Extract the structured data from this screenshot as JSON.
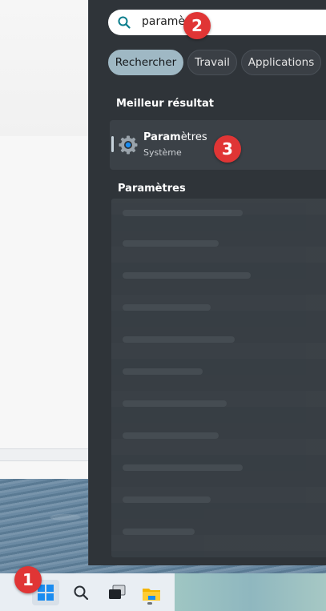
{
  "search": {
    "query": "paramè"
  },
  "filters": [
    {
      "label": "Rechercher",
      "active": true
    },
    {
      "label": "Travail",
      "active": false
    },
    {
      "label": "Applications",
      "active": false
    }
  ],
  "best_result": {
    "section_title": "Meilleur résultat",
    "title_match": "Param",
    "title_rest": "ètres",
    "subtitle": "Système"
  },
  "settings_section": {
    "title": "Paramètres"
  },
  "taskbar": {
    "icons": [
      "windows-start-icon",
      "search-icon",
      "task-view-icon",
      "file-explorer-icon"
    ]
  },
  "badges": [
    "1",
    "2",
    "3"
  ],
  "colors": {
    "panel_bg": "#2f3439",
    "accent_pill": "#9fb8c4",
    "badge": "#e03535",
    "start_blue": "#1a8cf0"
  }
}
